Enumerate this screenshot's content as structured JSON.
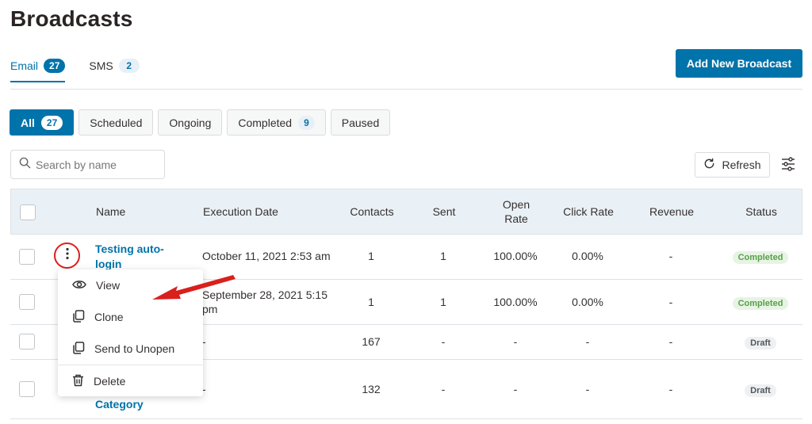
{
  "page": {
    "title": "Broadcasts"
  },
  "tabs": [
    {
      "label": "Email",
      "count": "27"
    },
    {
      "label": "SMS",
      "count": "2"
    }
  ],
  "actions": {
    "add_new": "Add New Broadcast",
    "refresh": "Refresh"
  },
  "filters": [
    {
      "label": "All",
      "count": "27"
    },
    {
      "label": "Scheduled"
    },
    {
      "label": "Ongoing"
    },
    {
      "label": "Completed",
      "count": "9"
    },
    {
      "label": "Paused"
    }
  ],
  "search": {
    "placeholder": "Search by name"
  },
  "table": {
    "columns": [
      "Name",
      "Execution Date",
      "Contacts",
      "Sent",
      "Open Rate",
      "Click Rate",
      "Revenue",
      "Status"
    ],
    "rows": [
      {
        "name": "Testing auto-login",
        "date": "October 11, 2021 2:53 am",
        "contacts": "1",
        "sent": "1",
        "open_rate": "100.00%",
        "click_rate": "0.00%",
        "revenue": "-",
        "status": "Completed"
      },
      {
        "name": "",
        "date": "September 28, 2021 5:15 pm",
        "contacts": "1",
        "sent": "1",
        "open_rate": "100.00%",
        "click_rate": "0.00%",
        "revenue": "-",
        "status": "Completed"
      },
      {
        "name": "",
        "date": "-",
        "contacts": "167",
        "sent": "-",
        "open_rate": "-",
        "click_rate": "-",
        "revenue": "-",
        "status": "Draft"
      },
      {
        "name": "Category",
        "date": "-",
        "contacts": "132",
        "sent": "-",
        "open_rate": "-",
        "click_rate": "-",
        "revenue": "-",
        "status": "Draft"
      }
    ]
  },
  "row_menu": {
    "items": [
      {
        "label": "View",
        "icon": "eye-icon"
      },
      {
        "label": "Clone",
        "icon": "copy-icon"
      },
      {
        "label": "Send to Unopen",
        "icon": "copy-icon"
      },
      {
        "label": "Delete",
        "icon": "trash-icon"
      }
    ]
  },
  "colors": {
    "accent": "#0073aa",
    "annotation": "#d9201c",
    "header_bg": "#eaf1f6"
  }
}
